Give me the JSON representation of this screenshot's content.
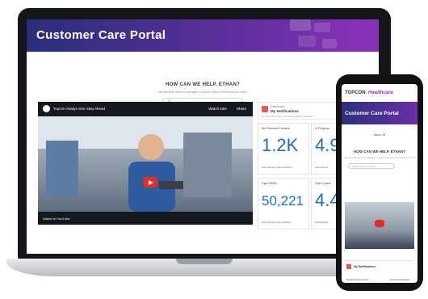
{
  "portal": {
    "title": "Customer Care Portal",
    "help_heading": "HOW CAN WE HELP, ETHAN?",
    "help_sub": "Use the links above to navigate, or search below to find what you need.",
    "search_placeholder": "Search for something..."
  },
  "video": {
    "title": "Topcon Always One Step Ahead",
    "watch_later": "Watch later",
    "share": "Share",
    "watch_on": "Watch on YouTube"
  },
  "notifications": {
    "label": "Dashboard",
    "title": "My Notifications",
    "sub": "As of Jul 26, 2019 · Viewing as Ethan Galleand"
  },
  "cards": [
    {
      "label": "Not Returned Loaners",
      "value": "1.2K",
      "link": "View Report (Loaner RMAs)"
    },
    {
      "label": "In Progress",
      "value": "4.9",
      "link": "View Report"
    },
    {
      "label": "Open RMAs",
      "value": "50,221",
      "link": "View Report (Open RMAs)"
    },
    {
      "label": "Open Cases",
      "value": "4.4",
      "link": "View Report"
    }
  ],
  "phone": {
    "logo_a": "TOPCON",
    "logo_b": "Healthcare",
    "title": "Customer Care Portal",
    "menu": "Menu",
    "help_heading": "HOW CAN WE HELP, ETHAN?",
    "help_sub": "Use the links above to navigate, or search below to find what you need.",
    "search_placeholder": "Search for something...",
    "notif_label": "Dashboard",
    "notif_title": "My Notifications",
    "bottom_left": "Not Returned Loaners",
    "bottom_right": "In Progress Repairs"
  },
  "colors": {
    "header_start": "#2a2f7a",
    "header_end": "#8a32b8",
    "value_blue": "#1f6fc0",
    "play_red": "#e52d27"
  }
}
